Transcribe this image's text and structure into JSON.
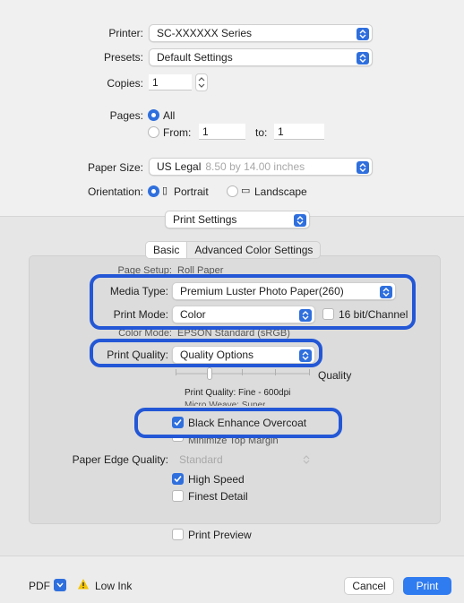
{
  "printer": {
    "label": "Printer:",
    "value": "SC-XXXXXX Series"
  },
  "presets": {
    "label": "Presets:",
    "value": "Default Settings"
  },
  "copies": {
    "label": "Copies:",
    "value": "1"
  },
  "pages": {
    "label": "Pages:",
    "all": "All",
    "from_label": "From:",
    "from_value": "1",
    "to_label": "to:",
    "to_value": "1"
  },
  "paper_size": {
    "label": "Paper Size:",
    "value": "US Legal",
    "detail": "8.50 by 14.00 inches"
  },
  "orientation": {
    "label": "Orientation:",
    "portrait": "Portrait",
    "landscape": "Landscape"
  },
  "section_popup": "Print Settings",
  "tabs": [
    {
      "label": "Basic"
    },
    {
      "label": "Advanced Color Settings"
    }
  ],
  "page_setup": {
    "label": "Page Setup:",
    "value": "Roll Paper"
  },
  "media_type": {
    "label": "Media Type:",
    "value": "Premium Luster Photo Paper(260)"
  },
  "print_mode": {
    "label": "Print Mode:",
    "value": "Color",
    "bit_label": "16 bit/Channel"
  },
  "color_mode": {
    "label": "Color Mode:",
    "value": "EPSON Standard (sRGB)"
  },
  "print_quality": {
    "label": "Print Quality:",
    "value": "Quality Options",
    "slider_label": "Quality",
    "slider_level": 0.25
  },
  "quality_info": {
    "line1": "Print Quality: Fine - 600dpi",
    "line2": "Micro Weave: Super"
  },
  "black_enhance": "Black Enhance Overcoat",
  "minimize_margin": "Minimize Top Margin",
  "paper_edge": {
    "label": "Paper Edge Quality:",
    "value": "Standard"
  },
  "high_speed": "High Speed",
  "finest_detail": "Finest Detail",
  "print_preview": "Print Preview",
  "footer": {
    "pdf": "PDF",
    "low_ink": "Low Ink",
    "cancel": "Cancel",
    "print": "Print"
  },
  "accent": "#2f6fdd",
  "highlight": "#2357d6"
}
